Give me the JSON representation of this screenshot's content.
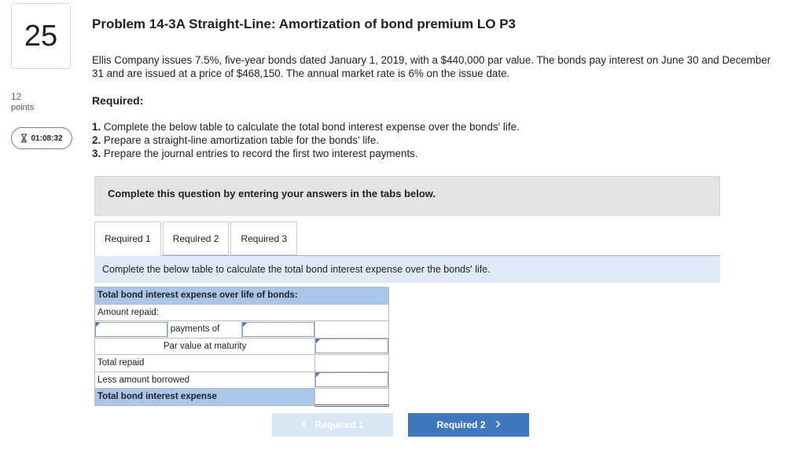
{
  "question": {
    "number": "25",
    "points_value": "12",
    "points_label": "points",
    "timer": "01:08:32"
  },
  "problem": {
    "title": "Problem 14-3A Straight-Line: Amortization of bond premium LO P3",
    "text": "Ellis Company issues 7.5%, five-year bonds dated January 1, 2019, with a $440,000 par value. The bonds pay interest on June 30 and December 31 and are issued at a price of $468,150. The annual market rate is 6% on the issue date.",
    "required_label": "Required:",
    "requirements": [
      {
        "num": "1.",
        "text": "Complete the below table to calculate the total bond interest expense over the bonds' life."
      },
      {
        "num": "2.",
        "text": "Prepare a straight-line amortization table for the bonds' life."
      },
      {
        "num": "3.",
        "text": "Prepare the journal entries to record the first two interest payments."
      }
    ]
  },
  "banner": "Complete this question by entering your answers in the tabs below.",
  "tabs": [
    {
      "label": "Required 1"
    },
    {
      "label": "Required 2"
    },
    {
      "label": "Required 3"
    }
  ],
  "instruction": "Complete the below table to calculate the total bond interest expense over the bonds' life.",
  "table": {
    "header": "Total bond interest expense over life of bonds:",
    "amount_repaid": "Amount repaid:",
    "payments_of": "payments of",
    "par_value": "Par value at maturity",
    "total_repaid": "Total repaid",
    "less_borrowed": "Less amount borrowed",
    "total_expense": "Total bond interest expense",
    "payments_count_value": "",
    "payment_amount_value": "",
    "payments_total_value": "",
    "par_value_value": "",
    "total_repaid_value": "",
    "less_borrowed_value": "",
    "total_expense_value": ""
  },
  "navigation": {
    "prev_label": "Required 1",
    "next_label": "Required 2",
    "prev_icon": "chevron-left-icon",
    "next_icon": "chevron-right-icon"
  },
  "colors": {
    "accent": "#3e79bd",
    "table_header": "#a9c6ea",
    "instruction_bg": "#dfeaf6"
  }
}
